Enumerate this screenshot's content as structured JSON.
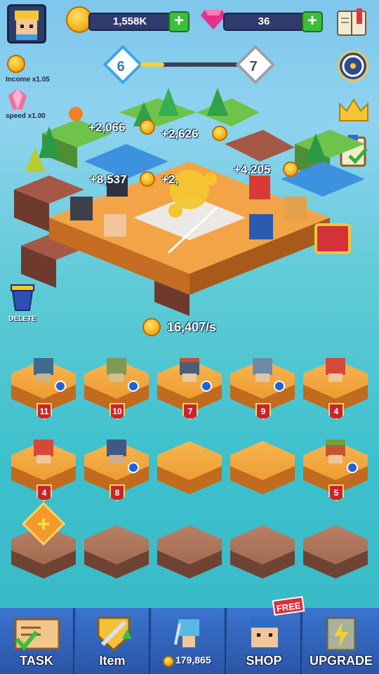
{
  "hud": {
    "coins": "1,558K",
    "gems": "36",
    "income_label": "Income x1.05",
    "speed_label": "speed x1.00"
  },
  "level": {
    "current": "6",
    "next": "7"
  },
  "board": {
    "popups": [
      "+2,066",
      "+2,626",
      "+8,537",
      "+2,",
      "+4,205"
    ]
  },
  "delete_label": "DELETE",
  "rate": "16,407/s",
  "grid": {
    "row1": [
      "11",
      "10",
      "7",
      "9",
      "4"
    ],
    "row2": [
      "4",
      "8",
      "",
      "",
      "5"
    ]
  },
  "nav": {
    "task": "TASK",
    "item": "Item",
    "buy_cost": "179,865",
    "shop": "SHOP",
    "free": "FREE",
    "upgrade": "UPGRADE"
  },
  "colors": {
    "accent_green": "#3bbf3a",
    "nav_blue": "#2c5dae",
    "badge_red": "#c9242c",
    "gold": "#f4b21b"
  }
}
